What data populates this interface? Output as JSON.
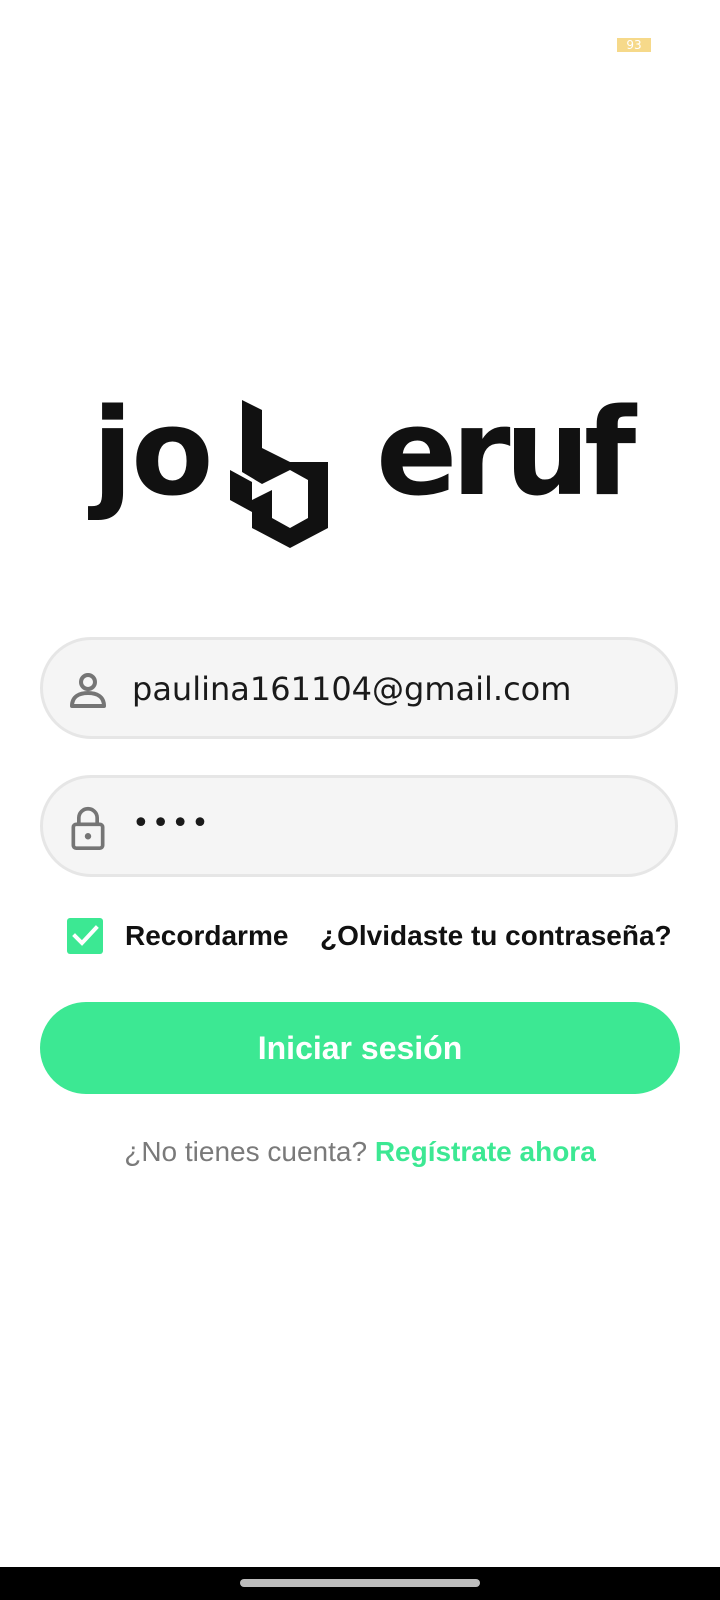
{
  "status_bar": {
    "battery": "93"
  },
  "brand": {
    "logo_left": "jo",
    "logo_right": "eruf",
    "accent": "#3ce893"
  },
  "login_form": {
    "email_icon": "person-icon",
    "email_value": "paulina161104@gmail.com",
    "password_icon": "lock-icon",
    "password_value": "••••",
    "remember_checked": true,
    "remember_label": "Recordarme",
    "forgot_label": "¿Olvidaste tu contraseña?",
    "submit_label": "Iniciar sesión"
  },
  "signup": {
    "prompt": "¿No tienes cuenta?",
    "link_label": "Regístrate ahora"
  }
}
